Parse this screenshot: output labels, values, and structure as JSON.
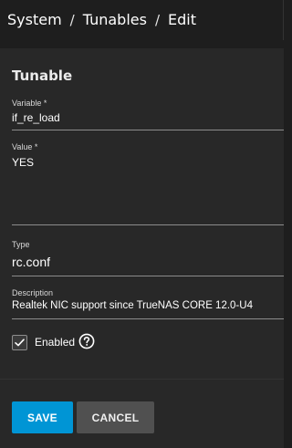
{
  "breadcrumb": {
    "items": [
      "System",
      "Tunables",
      "Edit"
    ],
    "separator": "/"
  },
  "form": {
    "title": "Tunable",
    "variable": {
      "label": "Variable *",
      "value": "if_re_load"
    },
    "value": {
      "label": "Value *",
      "value": "YES"
    },
    "type": {
      "label": "Type",
      "value": "rc.conf"
    },
    "description": {
      "label": "Description",
      "value": "Realtek NIC support since TrueNAS CORE 12.0-U4"
    },
    "enabled": {
      "label": "Enabled",
      "checked": true
    }
  },
  "actions": {
    "save_label": "SAVE",
    "cancel_label": "CANCEL"
  },
  "colors": {
    "primary": "#0095d5",
    "secondary": "#505050",
    "background": "#1e1e1e",
    "card": "#282828"
  },
  "icons": {
    "checkbox": "check-icon",
    "help": "help-circle-icon"
  }
}
